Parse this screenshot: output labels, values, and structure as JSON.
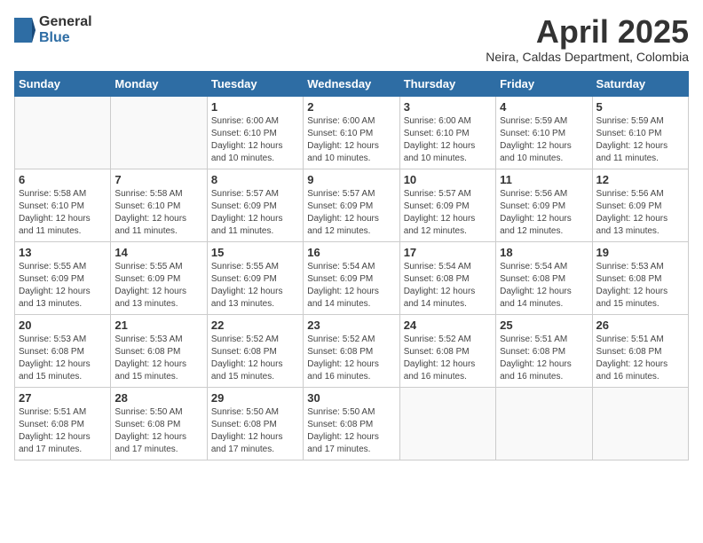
{
  "logo": {
    "general": "General",
    "blue": "Blue"
  },
  "title": "April 2025",
  "subtitle": "Neira, Caldas Department, Colombia",
  "weekdays": [
    "Sunday",
    "Monday",
    "Tuesday",
    "Wednesday",
    "Thursday",
    "Friday",
    "Saturday"
  ],
  "weeks": [
    [
      {
        "day": "",
        "info": ""
      },
      {
        "day": "",
        "info": ""
      },
      {
        "day": "1",
        "info": "Sunrise: 6:00 AM\nSunset: 6:10 PM\nDaylight: 12 hours and 10 minutes."
      },
      {
        "day": "2",
        "info": "Sunrise: 6:00 AM\nSunset: 6:10 PM\nDaylight: 12 hours and 10 minutes."
      },
      {
        "day": "3",
        "info": "Sunrise: 6:00 AM\nSunset: 6:10 PM\nDaylight: 12 hours and 10 minutes."
      },
      {
        "day": "4",
        "info": "Sunrise: 5:59 AM\nSunset: 6:10 PM\nDaylight: 12 hours and 10 minutes."
      },
      {
        "day": "5",
        "info": "Sunrise: 5:59 AM\nSunset: 6:10 PM\nDaylight: 12 hours and 11 minutes."
      }
    ],
    [
      {
        "day": "6",
        "info": "Sunrise: 5:58 AM\nSunset: 6:10 PM\nDaylight: 12 hours and 11 minutes."
      },
      {
        "day": "7",
        "info": "Sunrise: 5:58 AM\nSunset: 6:10 PM\nDaylight: 12 hours and 11 minutes."
      },
      {
        "day": "8",
        "info": "Sunrise: 5:57 AM\nSunset: 6:09 PM\nDaylight: 12 hours and 11 minutes."
      },
      {
        "day": "9",
        "info": "Sunrise: 5:57 AM\nSunset: 6:09 PM\nDaylight: 12 hours and 12 minutes."
      },
      {
        "day": "10",
        "info": "Sunrise: 5:57 AM\nSunset: 6:09 PM\nDaylight: 12 hours and 12 minutes."
      },
      {
        "day": "11",
        "info": "Sunrise: 5:56 AM\nSunset: 6:09 PM\nDaylight: 12 hours and 12 minutes."
      },
      {
        "day": "12",
        "info": "Sunrise: 5:56 AM\nSunset: 6:09 PM\nDaylight: 12 hours and 13 minutes."
      }
    ],
    [
      {
        "day": "13",
        "info": "Sunrise: 5:55 AM\nSunset: 6:09 PM\nDaylight: 12 hours and 13 minutes."
      },
      {
        "day": "14",
        "info": "Sunrise: 5:55 AM\nSunset: 6:09 PM\nDaylight: 12 hours and 13 minutes."
      },
      {
        "day": "15",
        "info": "Sunrise: 5:55 AM\nSunset: 6:09 PM\nDaylight: 12 hours and 13 minutes."
      },
      {
        "day": "16",
        "info": "Sunrise: 5:54 AM\nSunset: 6:09 PM\nDaylight: 12 hours and 14 minutes."
      },
      {
        "day": "17",
        "info": "Sunrise: 5:54 AM\nSunset: 6:08 PM\nDaylight: 12 hours and 14 minutes."
      },
      {
        "day": "18",
        "info": "Sunrise: 5:54 AM\nSunset: 6:08 PM\nDaylight: 12 hours and 14 minutes."
      },
      {
        "day": "19",
        "info": "Sunrise: 5:53 AM\nSunset: 6:08 PM\nDaylight: 12 hours and 15 minutes."
      }
    ],
    [
      {
        "day": "20",
        "info": "Sunrise: 5:53 AM\nSunset: 6:08 PM\nDaylight: 12 hours and 15 minutes."
      },
      {
        "day": "21",
        "info": "Sunrise: 5:53 AM\nSunset: 6:08 PM\nDaylight: 12 hours and 15 minutes."
      },
      {
        "day": "22",
        "info": "Sunrise: 5:52 AM\nSunset: 6:08 PM\nDaylight: 12 hours and 15 minutes."
      },
      {
        "day": "23",
        "info": "Sunrise: 5:52 AM\nSunset: 6:08 PM\nDaylight: 12 hours and 16 minutes."
      },
      {
        "day": "24",
        "info": "Sunrise: 5:52 AM\nSunset: 6:08 PM\nDaylight: 12 hours and 16 minutes."
      },
      {
        "day": "25",
        "info": "Sunrise: 5:51 AM\nSunset: 6:08 PM\nDaylight: 12 hours and 16 minutes."
      },
      {
        "day": "26",
        "info": "Sunrise: 5:51 AM\nSunset: 6:08 PM\nDaylight: 12 hours and 16 minutes."
      }
    ],
    [
      {
        "day": "27",
        "info": "Sunrise: 5:51 AM\nSunset: 6:08 PM\nDaylight: 12 hours and 17 minutes."
      },
      {
        "day": "28",
        "info": "Sunrise: 5:50 AM\nSunset: 6:08 PM\nDaylight: 12 hours and 17 minutes."
      },
      {
        "day": "29",
        "info": "Sunrise: 5:50 AM\nSunset: 6:08 PM\nDaylight: 12 hours and 17 minutes."
      },
      {
        "day": "30",
        "info": "Sunrise: 5:50 AM\nSunset: 6:08 PM\nDaylight: 12 hours and 17 minutes."
      },
      {
        "day": "",
        "info": ""
      },
      {
        "day": "",
        "info": ""
      },
      {
        "day": "",
        "info": ""
      }
    ]
  ]
}
